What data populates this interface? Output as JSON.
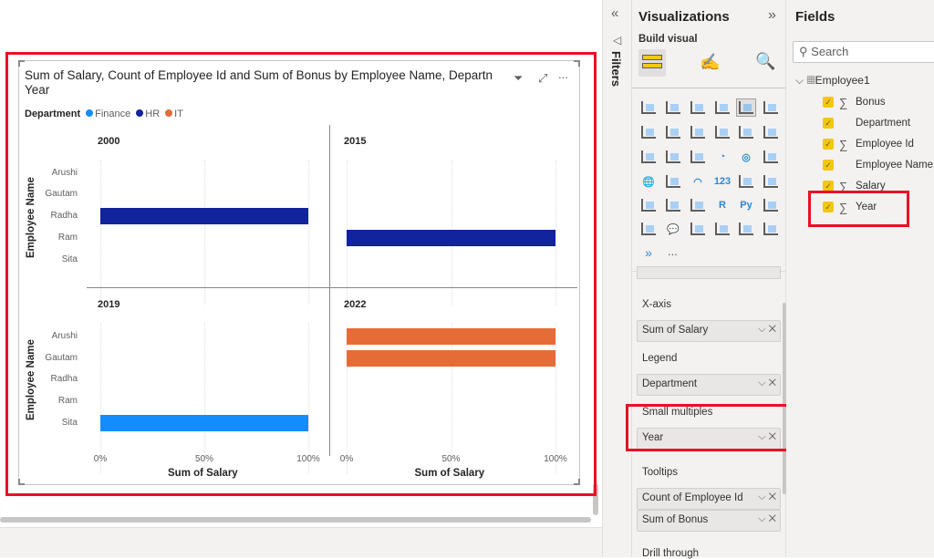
{
  "visual": {
    "title": "Sum of Salary, Count of Employee Id and Sum of Bonus by Employee Name, Departm... t and Year",
    "title_line1": "Sum of Salary, Count of Employee Id and Sum of Bonus by Employee Name, Departn",
    "title_line2": "Year",
    "more_label": "...",
    "legend_title": "Department",
    "legend": [
      {
        "label": "Finance",
        "color": "#118dff"
      },
      {
        "label": "HR",
        "color": "#12239e"
      },
      {
        "label": "IT",
        "color": "#e66c37"
      }
    ]
  },
  "chart_data": {
    "type": "bar",
    "subtype": "100% stacked horizontal bar, small multiples",
    "xlabel": "Sum of Salary",
    "ylabel": "Employee Name",
    "categories": [
      "Arushi",
      "Gautam",
      "Radha",
      "Ram",
      "Sita"
    ],
    "xticks": [
      "0%",
      "50%",
      "100%"
    ],
    "xlim": [
      0,
      100
    ],
    "panels": [
      {
        "title": "2000",
        "bars": [
          {
            "category": "Radha",
            "series": "HR",
            "value": 100
          }
        ]
      },
      {
        "title": "2015",
        "bars": [
          {
            "category": "Ram",
            "series": "HR",
            "value": 100
          }
        ]
      },
      {
        "title": "2019",
        "bars": [
          {
            "category": "Sita",
            "series": "Finance",
            "value": 100
          }
        ]
      },
      {
        "title": "2022",
        "bars": [
          {
            "category": "Arushi",
            "series": "IT",
            "value": 100
          },
          {
            "category": "Gautam",
            "series": "IT",
            "value": 100
          }
        ]
      }
    ]
  },
  "filters": {
    "label": "Filters"
  },
  "viz_pane": {
    "title": "Visualizations",
    "build_visual": "Build visual",
    "wells": [
      {
        "label": "X-axis",
        "items": [
          "Sum of Salary"
        ]
      },
      {
        "label": "Legend",
        "items": [
          "Department"
        ]
      },
      {
        "label": "Small multiples",
        "items": [
          "Year"
        ]
      },
      {
        "label": "Tooltips",
        "items": [
          "Count of Employee Id",
          "Sum of Bonus"
        ]
      },
      {
        "label": "Drill through",
        "items": []
      }
    ],
    "more_visuals": "..."
  },
  "fields_pane": {
    "title": "Fields",
    "search_placeholder": "Search",
    "table": "Employee1",
    "fields": [
      {
        "name": "Bonus",
        "sigma": true
      },
      {
        "name": "Department",
        "sigma": false
      },
      {
        "name": "Employee Id",
        "sigma": true
      },
      {
        "name": "Employee Name",
        "sigma": false
      },
      {
        "name": "Salary",
        "sigma": true
      },
      {
        "name": "Year",
        "sigma": true
      }
    ]
  }
}
